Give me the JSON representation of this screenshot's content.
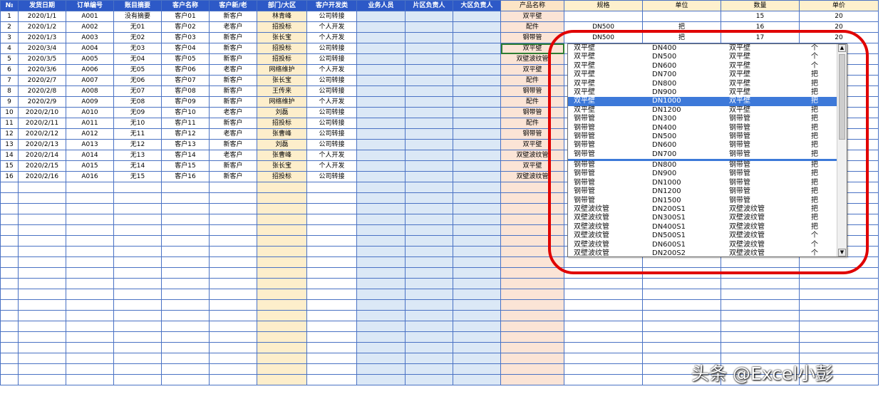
{
  "headers": [
    "№",
    "发货日期",
    "订单编号",
    "账目摘要",
    "客户名称",
    "客户新/老",
    "部门/大区",
    "客户开发类",
    "业务人员",
    "片区负责人",
    "大区负责人",
    "产品名称",
    "规格",
    "单位",
    "数量",
    "单价"
  ],
  "rows": [
    [
      "1",
      "2020/1/1",
      "A001",
      "没有摘要",
      "客户01",
      "新客户",
      "林青峰",
      "公司转接",
      "双平壁",
      "",
      "",
      "15",
      "20"
    ],
    [
      "2",
      "2020/1/2",
      "A002",
      "无01",
      "客户02",
      "老客户",
      "招投标",
      "个人开发",
      "配件",
      "DN500",
      "把",
      "16",
      "20"
    ],
    [
      "3",
      "2020/1/3",
      "A003",
      "无02",
      "客户03",
      "新客户",
      "张长宝",
      "个人开发",
      "钢带管",
      "DN500",
      "把",
      "17",
      "20"
    ],
    [
      "4",
      "2020/3/4",
      "A004",
      "无03",
      "客户04",
      "新客户",
      "招投标",
      "公司转接",
      "双平壁",
      "",
      "",
      "",
      ""
    ],
    [
      "5",
      "2020/3/5",
      "A005",
      "无04",
      "客户05",
      "新客户",
      "招投标",
      "公司转接",
      "双壁波纹管",
      "",
      "",
      "",
      ""
    ],
    [
      "6",
      "2020/3/6",
      "A006",
      "无05",
      "客户06",
      "老客户",
      "网络维护",
      "个人开发",
      "双平壁",
      "",
      "",
      "",
      ""
    ],
    [
      "7",
      "2020/2/7",
      "A007",
      "无06",
      "客户07",
      "新客户",
      "张长宝",
      "公司转接",
      "配件",
      "",
      "",
      "",
      ""
    ],
    [
      "8",
      "2020/2/8",
      "A008",
      "无07",
      "客户08",
      "新客户",
      "王传来",
      "公司转接",
      "钢带管",
      "",
      "",
      "",
      ""
    ],
    [
      "9",
      "2020/2/9",
      "A009",
      "无08",
      "客户09",
      "新客户",
      "网络维护",
      "个人开发",
      "配件",
      "",
      "",
      "",
      ""
    ],
    [
      "10",
      "2020/2/10",
      "A010",
      "无09",
      "客户10",
      "老客户",
      "刘磊",
      "公司转接",
      "钢带管",
      "",
      "",
      "",
      ""
    ],
    [
      "11",
      "2020/2/11",
      "A011",
      "无10",
      "客户11",
      "新客户",
      "招投标",
      "公司转接",
      "配件",
      "",
      "",
      "",
      ""
    ],
    [
      "12",
      "2020/2/12",
      "A012",
      "无11",
      "客户12",
      "老客户",
      "张曹峰",
      "公司转接",
      "钢带管",
      "",
      "",
      "",
      ""
    ],
    [
      "13",
      "2020/2/13",
      "A013",
      "无12",
      "客户13",
      "新客户",
      "刘磊",
      "公司转接",
      "双平壁",
      "",
      "",
      "",
      ""
    ],
    [
      "14",
      "2020/2/14",
      "A014",
      "无13",
      "客户14",
      "老客户",
      "张曹峰",
      "个人开发",
      "双壁波纹管",
      "",
      "",
      "",
      ""
    ],
    [
      "15",
      "2020/2/15",
      "A015",
      "无14",
      "客户15",
      "新客户",
      "张长宝",
      "个人开发",
      "双平壁",
      "",
      "",
      "",
      ""
    ],
    [
      "16",
      "2020/2/16",
      "A016",
      "无15",
      "客户16",
      "新客户",
      "招投标",
      "公司转接",
      "双壁波纹管",
      "",
      "",
      "",
      ""
    ]
  ],
  "dropdown": {
    "items": [
      [
        "双平壁",
        "DN400",
        "双平壁",
        "个"
      ],
      [
        "双平壁",
        "DN500",
        "双平壁",
        "个"
      ],
      [
        "双平壁",
        "DN600",
        "双平壁",
        "个"
      ],
      [
        "双平壁",
        "DN700",
        "双平壁",
        "把"
      ],
      [
        "双平壁",
        "DN800",
        "双平壁",
        "把"
      ],
      [
        "双平壁",
        "DN900",
        "双平壁",
        "把"
      ],
      [
        "双平壁",
        "DN1000",
        "双平壁",
        "把"
      ],
      [
        "双平壁",
        "DN1200",
        "双平壁",
        "把"
      ],
      [
        "钢带管",
        "DN300",
        "钢带管",
        "把"
      ],
      [
        "钢带管",
        "DN400",
        "钢带管",
        "把"
      ],
      [
        "钢带管",
        "DN500",
        "钢带管",
        "把"
      ],
      [
        "钢带管",
        "DN600",
        "钢带管",
        "把"
      ],
      [
        "钢带管",
        "DN700",
        "钢带管",
        "把"
      ],
      [
        "钢带管",
        "DN800",
        "钢带管",
        "把"
      ],
      [
        "钢带管",
        "DN900",
        "钢带管",
        "把"
      ],
      [
        "钢带管",
        "DN1000",
        "钢带管",
        "把"
      ],
      [
        "钢带管",
        "DN1200",
        "钢带管",
        "把"
      ],
      [
        "钢带管",
        "DN1500",
        "钢带管",
        "把"
      ],
      [
        "双壁波纹管",
        "DN200S1",
        "双壁波纹管",
        "把"
      ],
      [
        "双壁波纹管",
        "DN300S1",
        "双壁波纹管",
        "把"
      ],
      [
        "双壁波纹管",
        "DN400S1",
        "双壁波纹管",
        "把"
      ],
      [
        "双壁波纹管",
        "DN500S1",
        "双壁波纹管",
        "个"
      ],
      [
        "双壁波纹管",
        "DN600S1",
        "双壁波纹管",
        "个"
      ],
      [
        "双壁波纹管",
        "DN200S2",
        "双壁波纹管",
        "个"
      ]
    ],
    "selected_index": 6,
    "separator_after": 12
  },
  "watermark": "头条 @Excel小彭",
  "colors": {
    "header": "#2d59c7",
    "selection": "#3d79d9",
    "annotation": "#e00000"
  }
}
